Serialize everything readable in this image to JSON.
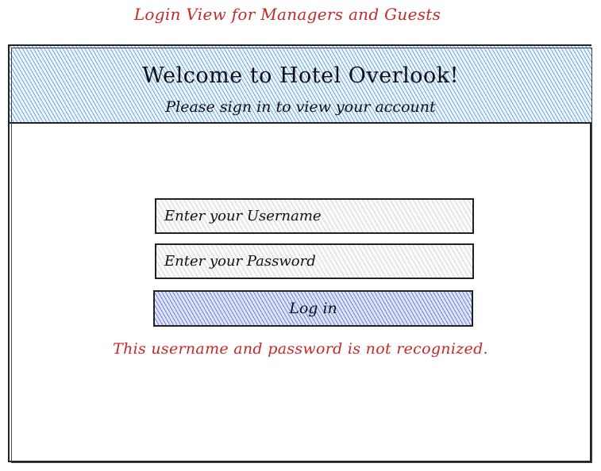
{
  "annotation": {
    "title": "Login View for Managers and Guests"
  },
  "header": {
    "title": "Welcome to Hotel Overlook!",
    "subtitle": "Please sign in to view your account"
  },
  "login_form": {
    "username_placeholder": "Enter your Username",
    "password_placeholder": "Enter your Password",
    "login_label": "Log in",
    "error_message": "This username and password is not recognized."
  },
  "colors": {
    "header_fill": "#428cda",
    "button_fill": "#4664d2",
    "annotation_text": "#c62828",
    "error_text": "#c62828"
  }
}
